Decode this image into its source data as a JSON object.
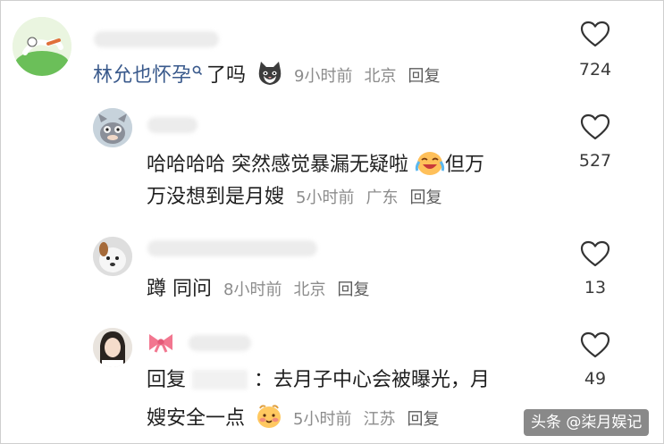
{
  "comments": [
    {
      "username_hidden": true,
      "text_parts": [
        "林允也怀孕",
        "了吗"
      ],
      "meta_time": "9小时前",
      "meta_location": "北京",
      "reply_label": "回复",
      "likes": "724"
    },
    {
      "username_hidden": true,
      "text_line1": "哈哈哈哈 突然感觉暴漏无疑啦",
      "text_line1_tail": "但万",
      "text_line2": "万没想到是月嫂",
      "meta_time": "5小时前",
      "meta_location": "广东",
      "reply_label": "回复",
      "likes": "527"
    },
    {
      "username_hidden": true,
      "text": "蹲 同问",
      "meta_time": "8小时前",
      "meta_location": "北京",
      "reply_label": "回复",
      "likes": "13"
    },
    {
      "username_hidden": true,
      "reply_prefix": "回复",
      "text_line1": "：去月子中心会被曝光，月",
      "text_line2": "嫂安全一点",
      "meta_time": "5小时前",
      "meta_location": "江苏",
      "reply_label": "回复",
      "likes": "49"
    }
  ],
  "watermark": "头条 @柒月娱记",
  "icons": {
    "like": "heart-outline-icon",
    "search_suffix": "search-icon",
    "cat_emoji": "cat-face-icon",
    "crying_emoji": "crying-laughing-face-icon",
    "shy_emoji": "shy-face-icon",
    "bow": "pink-bow-icon"
  },
  "colors": {
    "link_blue": "#3a5a8c",
    "meta_gray": "#8c8c8c",
    "heart_stroke": "#333333"
  }
}
